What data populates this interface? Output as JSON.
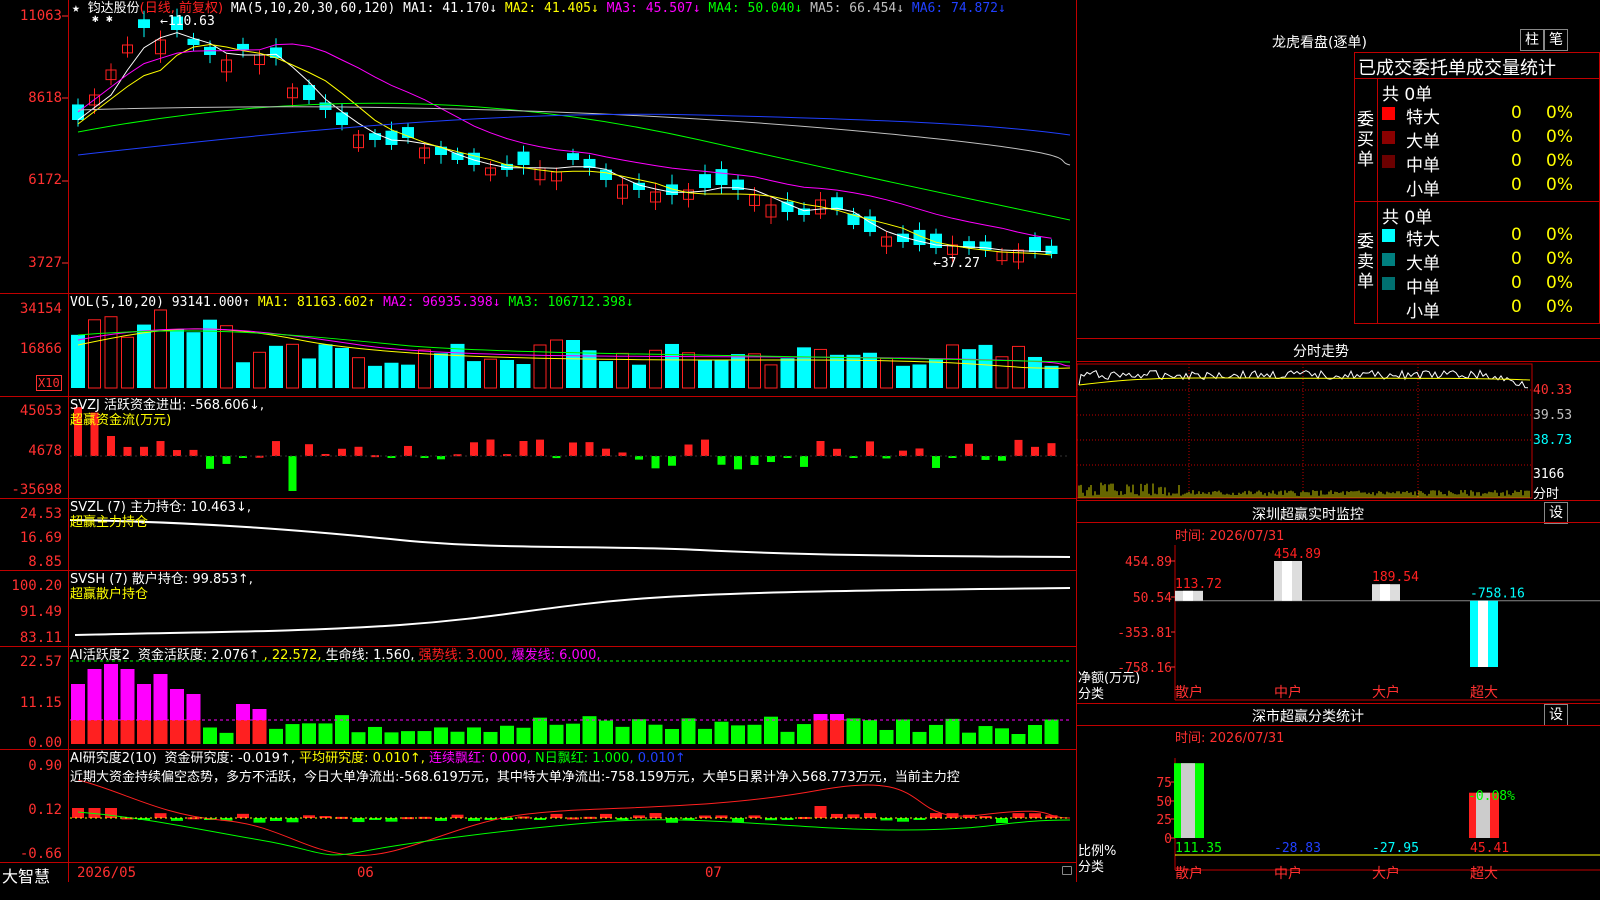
{
  "colors": {
    "up": "#ff2020",
    "down": "#00ffff",
    "grid": "#c00000",
    "yellow": "#ffff00",
    "magenta": "#ff00ff",
    "green": "#00ff00",
    "blue": "#2040ff",
    "white": "#ffffff",
    "gray": "#c0c0c0",
    "axis": "#ff3030"
  },
  "main": {
    "star": "★",
    "stock_name": "钧达股份",
    "mode": "(日线, 前复权)",
    "ma_title": "MA(5,10,20,30,60,120)",
    "ma": [
      {
        "label": "MA1: 41.170↓",
        "color": "#ffffff"
      },
      {
        "label": "MA2: 41.405↓",
        "color": "#ffff00"
      },
      {
        "label": "MA3: 45.507↓",
        "color": "#ff00ff"
      },
      {
        "label": "MA4: 50.040↓",
        "color": "#00ff00"
      },
      {
        "label": "MA5: 66.454↓",
        "color": "#c0c0c0"
      },
      {
        "label": "MA6: 74.872↓",
        "color": "#2040ff"
      }
    ],
    "y_labels": [
      "11063",
      "8618",
      "6172",
      "3727"
    ],
    "high_note": "110.63",
    "low_note": "←37.27",
    "high_arrow": "←"
  },
  "vol": {
    "title": "VOL(5,10,20)",
    "value": "93141.000↑",
    "ma": [
      {
        "label": "MA1: 81163.602↑",
        "color": "#ffff00"
      },
      {
        "label": "MA2: 96935.398↓",
        "color": "#ff00ff"
      },
      {
        "label": "MA3: 106712.398↓",
        "color": "#00ff00"
      }
    ],
    "y_labels": [
      "34154",
      "16866"
    ],
    "unit": "X10"
  },
  "svzj": {
    "title": "SVZJ  活跃资金进出: -568.606↓,",
    "subtitle": "超赢资金流(万元)",
    "y_labels": [
      "45053",
      "4678",
      "-35698"
    ]
  },
  "svzl": {
    "title": "SVZL (7) 主力持仓: 10.463↓,",
    "subtitle": "超赢主力持仓",
    "y_labels": [
      "24.53",
      "16.69",
      "8.85"
    ]
  },
  "svsh": {
    "title": "SVSH (7) 散户持仓: 99.853↑,",
    "subtitle": "超赢散户持仓",
    "y_labels": [
      "100.20",
      "91.49",
      "83.11"
    ]
  },
  "ai1": {
    "title": "AI活跃度2",
    "items": [
      {
        "label": "资金活跃度: 2.076↑",
        "color": "#ffffff"
      },
      {
        "label": ", 22.572,",
        "color": "#ffff00"
      },
      {
        "label": "生命线: 1.560,",
        "color": "#ffffff"
      },
      {
        "label": "强势线: 3.000,",
        "color": "#ff2020"
      },
      {
        "label": "爆发线: 6.000,",
        "color": "#ff00ff"
      }
    ],
    "y_labels": [
      "22.57",
      "11.15",
      "0.00"
    ]
  },
  "ai2": {
    "title": "AI研究度2(10)",
    "items": [
      {
        "label": "资金研究度: -0.019↑,",
        "color": "#ffffff"
      },
      {
        "label": "平均研究度: 0.010↑,",
        "color": "#ffff00"
      },
      {
        "label": "连续飘红: 0.000,",
        "color": "#ff00ff"
      },
      {
        "label": "N日飘红: 1.000,",
        "color": "#00ff00"
      },
      {
        "label": "0.010↑",
        "color": "#2040ff"
      }
    ],
    "desc": "近期大资金持续偏空态势，多方不活跃，今日大单净流出:-568.619万元，其中特大单净流出:-758.159万元，大单5日累计净入568.773万元，当前主力控",
    "y_labels": [
      "0.90",
      "0.12",
      "-0.66"
    ]
  },
  "bottom": {
    "brand": "大智慧",
    "dates": [
      "2026/05",
      "06",
      "07"
    ]
  },
  "lhb": {
    "title": "龙虎看盘(逐单)",
    "btn1": "柱",
    "btn2": "笔",
    "header": "已成交委托单成交量统计",
    "buy": {
      "side": "委买单",
      "count": "共 0单",
      "rows": [
        {
          "label": "特大",
          "vol": "0",
          "pct": "0%",
          "color": "#ff0000"
        },
        {
          "label": "大单",
          "vol": "0",
          "pct": "0%",
          "color": "#8b0000"
        },
        {
          "label": "中单",
          "vol": "0",
          "pct": "0%",
          "color": "#6b0000"
        },
        {
          "label": "小单",
          "vol": "0",
          "pct": "0%",
          "color": "#000000"
        }
      ]
    },
    "sell": {
      "side": "委卖单",
      "count": "共 0单",
      "rows": [
        {
          "label": "特大",
          "vol": "0",
          "pct": "0%",
          "color": "#00ffff"
        },
        {
          "label": "大单",
          "vol": "0",
          "pct": "0%",
          "color": "#008080"
        },
        {
          "label": "中单",
          "vol": "0",
          "pct": "0%",
          "color": "#007070"
        },
        {
          "label": "小单",
          "vol": "0",
          "pct": "0%",
          "color": "#000000"
        }
      ]
    }
  },
  "fenshi": {
    "title": "分时走势",
    "prices": [
      "40.33",
      "39.53",
      "38.73"
    ],
    "vol_label": "3166",
    "vol_unit": "分时"
  },
  "sz_monitor": {
    "title": "深圳超赢实时监控",
    "btn": "设",
    "date": "时间: 2026/07/31",
    "y_labels": [
      "454.89",
      "50.54",
      "-353.81",
      "-758.16"
    ],
    "ylabel1": "净额(万元)",
    "ylabel2": "分类",
    "chart_data": {
      "type": "bar",
      "categories": [
        "散户",
        "中户",
        "大户",
        "超大"
      ],
      "values": [
        113.72,
        454.89,
        189.54,
        -758.16
      ],
      "value_labels": [
        "113.72",
        "454.89",
        "189.54",
        "-758.16"
      ],
      "ylim": [
        -758.16,
        454.89
      ]
    }
  },
  "sz_class": {
    "title": "深市超赢分类统计",
    "btn": "设",
    "date": "时间: 2026/07/31",
    "y_labels": [
      "75",
      "50",
      "25",
      "0"
    ],
    "ylabel1": "比例%",
    "ylabel2": "分类",
    "top_label": "-0.08%",
    "chart_data": {
      "type": "bar",
      "categories": [
        "散户",
        "中户",
        "大户",
        "超大"
      ],
      "values": [
        111.35,
        -28.83,
        -27.95,
        45.41
      ],
      "value_labels": [
        "111.35",
        "-28.83",
        "-27.95",
        "45.41"
      ],
      "ylim": [
        0,
        100
      ]
    }
  }
}
